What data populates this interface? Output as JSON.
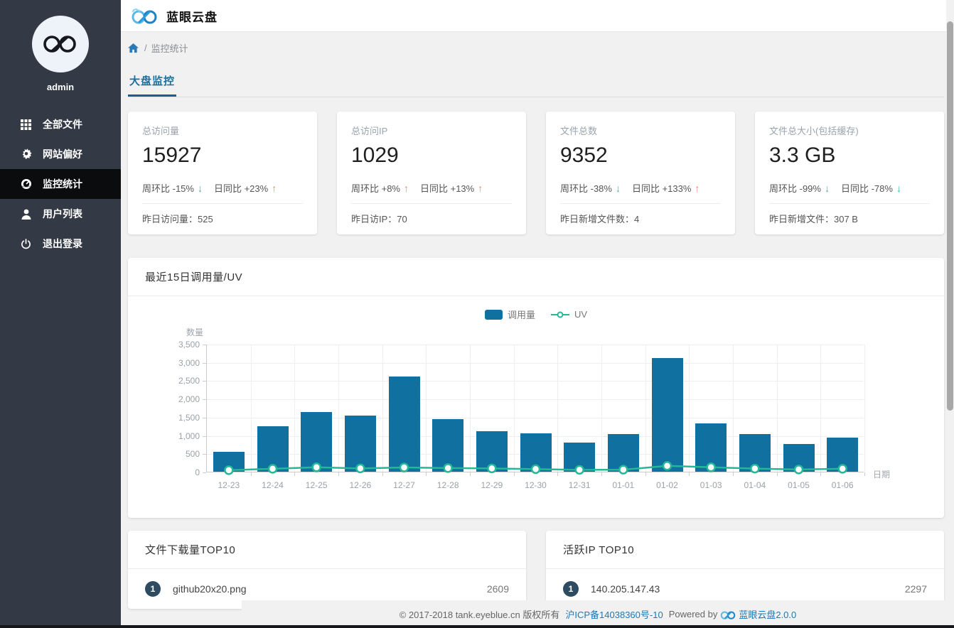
{
  "app": {
    "title": "蓝眼云盘"
  },
  "sidebar": {
    "username": "admin",
    "items": [
      {
        "label": "全部文件",
        "icon": "grid-icon",
        "active": false
      },
      {
        "label": "网站偏好",
        "icon": "gear-icon",
        "active": false
      },
      {
        "label": "监控统计",
        "icon": "dashboard-icon",
        "active": true
      },
      {
        "label": "用户列表",
        "icon": "user-icon",
        "active": false
      },
      {
        "label": "退出登录",
        "icon": "power-icon",
        "active": false
      }
    ]
  },
  "breadcrumb": {
    "separator": "/",
    "current": "监控统计"
  },
  "tabs": [
    {
      "label": "大盘监控",
      "active": true
    }
  ],
  "icons": {
    "arrow_up": "↑",
    "arrow_down": "↓"
  },
  "stat_cards": [
    {
      "label": "总访问量",
      "value": "15927",
      "trend1_text": "周环比 -15%",
      "trend1_dir": "down",
      "trend2_text": "日同比 +23%",
      "trend2_dir": "up",
      "footer_text": "昨日访问量：525"
    },
    {
      "label": "总访问IP",
      "value": "1029",
      "trend1_text": "周环比 +8%",
      "trend1_dir": "up",
      "trend2_text": "日同比 +13%",
      "trend2_dir": "up",
      "footer_text": "昨日访IP：70"
    },
    {
      "label": "文件总数",
      "value": "9352",
      "trend1_text": "周环比 -38%",
      "trend1_dir": "down",
      "trend2_text": "日同比 +133%",
      "trend2_dir": "up",
      "footer_text": "昨日新增文件数：4"
    },
    {
      "label": "文件总大小(包括缓存)",
      "value": "3.3 GB",
      "trend1_text": "周环比 -99%",
      "trend1_dir": "down",
      "trend2_text": "日同比 -78%",
      "trend2_dir": "down",
      "footer_text": "昨日新增文件：307 B"
    }
  ],
  "chart_card_title": "最近15日调用量/UV",
  "chart_data": {
    "type": "bar",
    "title": "最近15日调用量/UV",
    "categories": [
      "12-23",
      "12-24",
      "12-25",
      "12-26",
      "12-27",
      "12-28",
      "12-29",
      "12-30",
      "12-31",
      "01-01",
      "01-02",
      "01-03",
      "01-04",
      "01-05",
      "01-06"
    ],
    "series": [
      {
        "name": "调用量",
        "type": "bar",
        "values": [
          540,
          1250,
          1640,
          1530,
          2600,
          1440,
          1100,
          1050,
          790,
          1030,
          3110,
          1320,
          1030,
          760,
          940
        ]
      },
      {
        "name": "UV",
        "type": "line",
        "values": [
          60,
          100,
          140,
          110,
          135,
          120,
          110,
          90,
          70,
          75,
          180,
          140,
          105,
          80,
          100
        ]
      }
    ],
    "xlabel": "日期",
    "ylabel": "数量",
    "ylim": [
      0,
      3500
    ],
    "ytick_step": 500,
    "grid": true,
    "legend_position": "top-center"
  },
  "top_lists": [
    {
      "title": "文件下载量TOP10",
      "rows": [
        {
          "rank": "1",
          "name": "github20x20.png",
          "value": "2609"
        }
      ]
    },
    {
      "title": "活跃IP TOP10",
      "rows": [
        {
          "rank": "1",
          "name": "140.205.147.43",
          "value": "2297"
        }
      ]
    }
  ],
  "footer": {
    "copyright": "© 2017-2018 tank.eyeblue.cn 版权所有",
    "icp_link": "沪ICP备14038360号-10",
    "powered_by": "Powered by",
    "product_link": "蓝眼云盘2.0.0"
  },
  "colors": {
    "bar": "#10709f",
    "line": "#25b896",
    "arrow_up": "#f4826c",
    "arrow_down": "#2cbc9e",
    "sidebar_bg": "#333945",
    "active_item_bg": "#0b0c0e",
    "tab_blue": "#1a6f9f",
    "link_blue": "#1f78b4",
    "badge": "#2e4b61"
  }
}
